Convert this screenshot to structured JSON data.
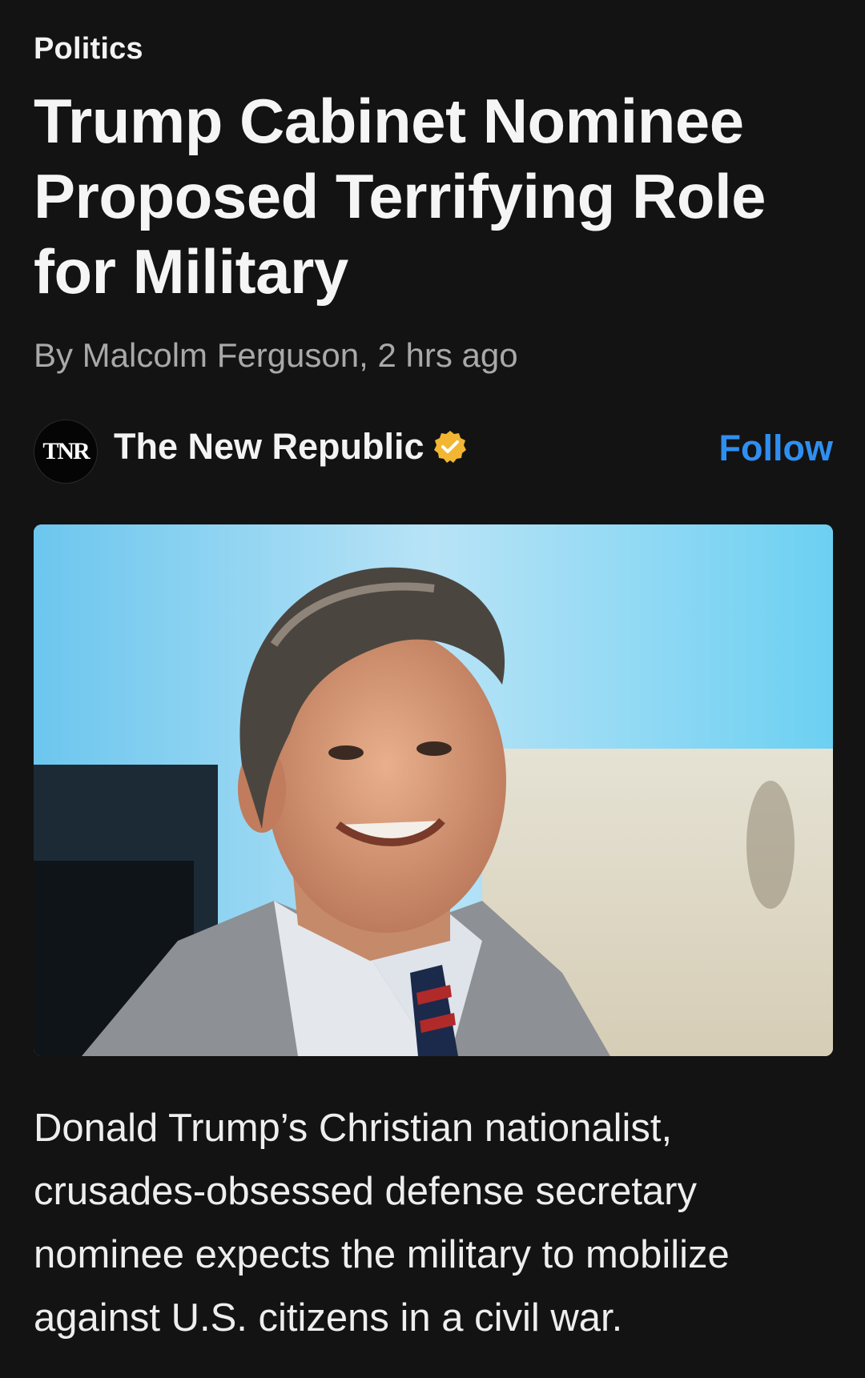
{
  "article": {
    "category": "Politics",
    "headline": "Trump Cabinet Nominee Proposed Terrifying Role for Military",
    "byline": "By Malcolm Ferguson, 2 hrs ago",
    "summary": "Donald Trump’s Christian nationalist, crusades-obsessed defense secretary nominee expects the military to mobilize against U.S. citizens in a civil war."
  },
  "publisher": {
    "logo_text": "TNR",
    "name": "The New Republic",
    "verified_icon": "verified-badge-icon",
    "follow_label": "Follow"
  },
  "colors": {
    "background": "#131313",
    "accent": "#2f8ff0",
    "verified": "#f2b632",
    "byline": "#a9a9a9"
  }
}
